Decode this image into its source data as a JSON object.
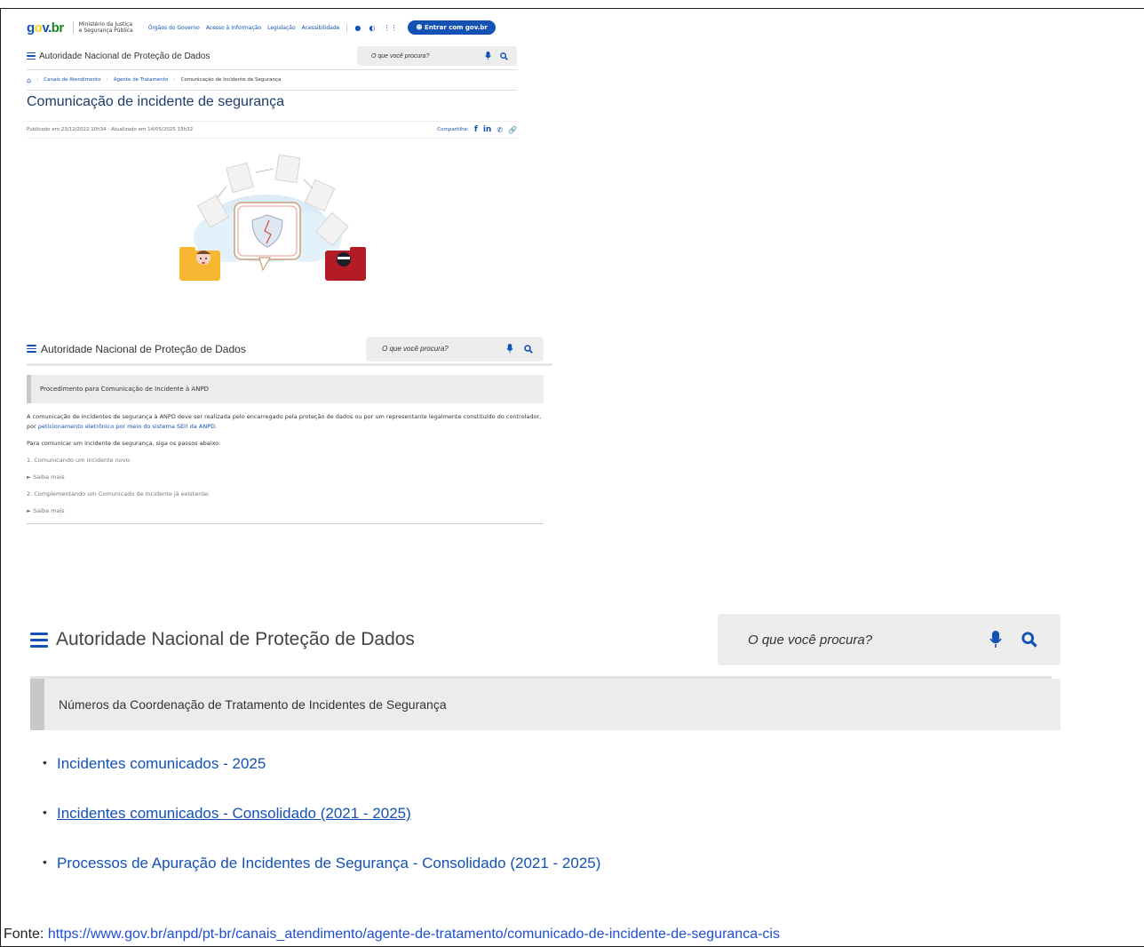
{
  "govbar": {
    "logo": "gov.br",
    "ministry": "Ministério da Justiça e Segurança Pública",
    "links": [
      "Órgãos do Governo",
      "Acesso à Informação",
      "Legislação",
      "Acessibilidade"
    ],
    "login_label": "Entrar com gov.br"
  },
  "site": {
    "name": "Autoridade Nacional de Proteção de Dados",
    "search_placeholder": "O que você procura?"
  },
  "breadcrumb": {
    "items": [
      "Canais de Atendimento",
      "Agente de Tratamento",
      "Comunicação de Incidente de Segurança"
    ]
  },
  "page": {
    "title": "Comunicação de incidente de segurança",
    "published": "Publicado em 23/12/2022 10h34",
    "updated": "Atualizado em 14/05/2025 15h32",
    "share_label": "Compartilhe:"
  },
  "procedure": {
    "title": "Procedimento para Comunicação de Incidente à ANPD",
    "intro_text": "A comunicação de incidentes de segurança à ANPD deve ser realizada pelo encarregado pela proteção de dados ou por um representante legalmente constituído do controlador, por",
    "intro_link": "peticionamento eletrônico por meio do sistema SEI! da ANPD.",
    "steps_heading": "Para comunicar um incidente de segurança, siga os passos abaixo:",
    "step1": "1. Comunicando um incidente novo:",
    "step2": "2. Complementando um Comunicado de Incidente já existente:",
    "saiba_mais": "Saiba mais"
  },
  "numbers": {
    "title": "Números da Coordenação de Tratamento de Incidentes de Segurança",
    "links": [
      "Incidentes comunicados - 2025",
      "Incidentes comunicados - Consolidado (2021 - 2025)",
      "Processos de Apuração de Incidentes de Segurança - Consolidado (2021 - 2025)"
    ]
  },
  "source": {
    "label": "Fonte:",
    "url": "https://www.gov.br/anpd/pt-br/canais_atendimento/agente-de-tratamento/comunicado-de-incidente-de-seguranca-cis"
  },
  "colors": {
    "primary": "#1351b4",
    "title": "#1b3c6d",
    "panel": "#ececec"
  },
  "icons": [
    "hamburger-icon",
    "microphone-icon",
    "search-icon",
    "home-icon",
    "facebook-icon",
    "linkedin-icon",
    "whatsapp-icon",
    "link-icon",
    "user-icon",
    "contrast-icon",
    "apps-icon"
  ]
}
